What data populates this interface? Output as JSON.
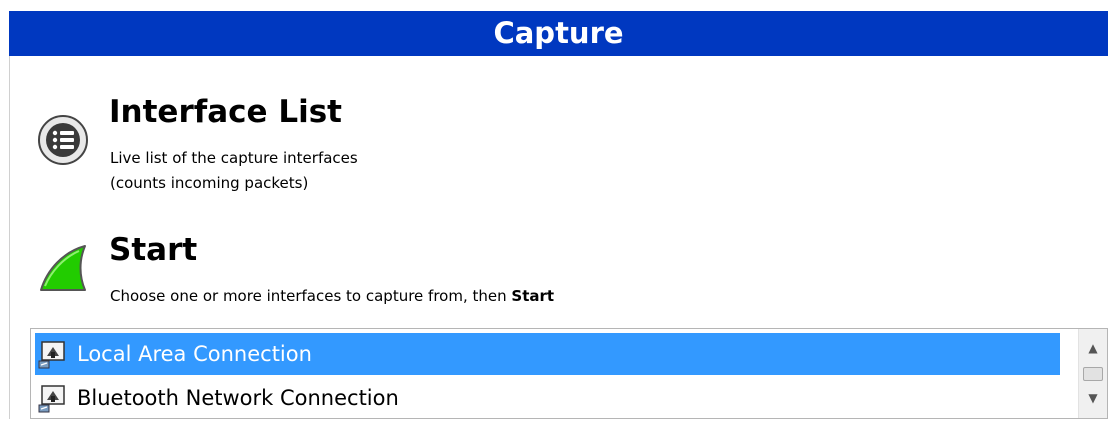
{
  "header": {
    "title": "Capture"
  },
  "interface_list": {
    "title": "Interface List",
    "desc_line1": "Live list of the capture interfaces",
    "desc_line2": "(counts incoming packets)"
  },
  "start": {
    "title": "Start",
    "desc_prefix": "Choose one or more interfaces to capture from, then ",
    "desc_bold": "Start"
  },
  "interfaces": [
    {
      "label": "Local Area Connection",
      "selected": true
    },
    {
      "label": "Bluetooth Network Connection",
      "selected": false
    }
  ],
  "colors": {
    "header": "#0038c0",
    "selection": "#3399ff",
    "fin": "#22cc00"
  },
  "icons": {
    "interface_list": "list-icon",
    "start": "shark-fin-icon",
    "interface": "network-adapter-icon"
  }
}
